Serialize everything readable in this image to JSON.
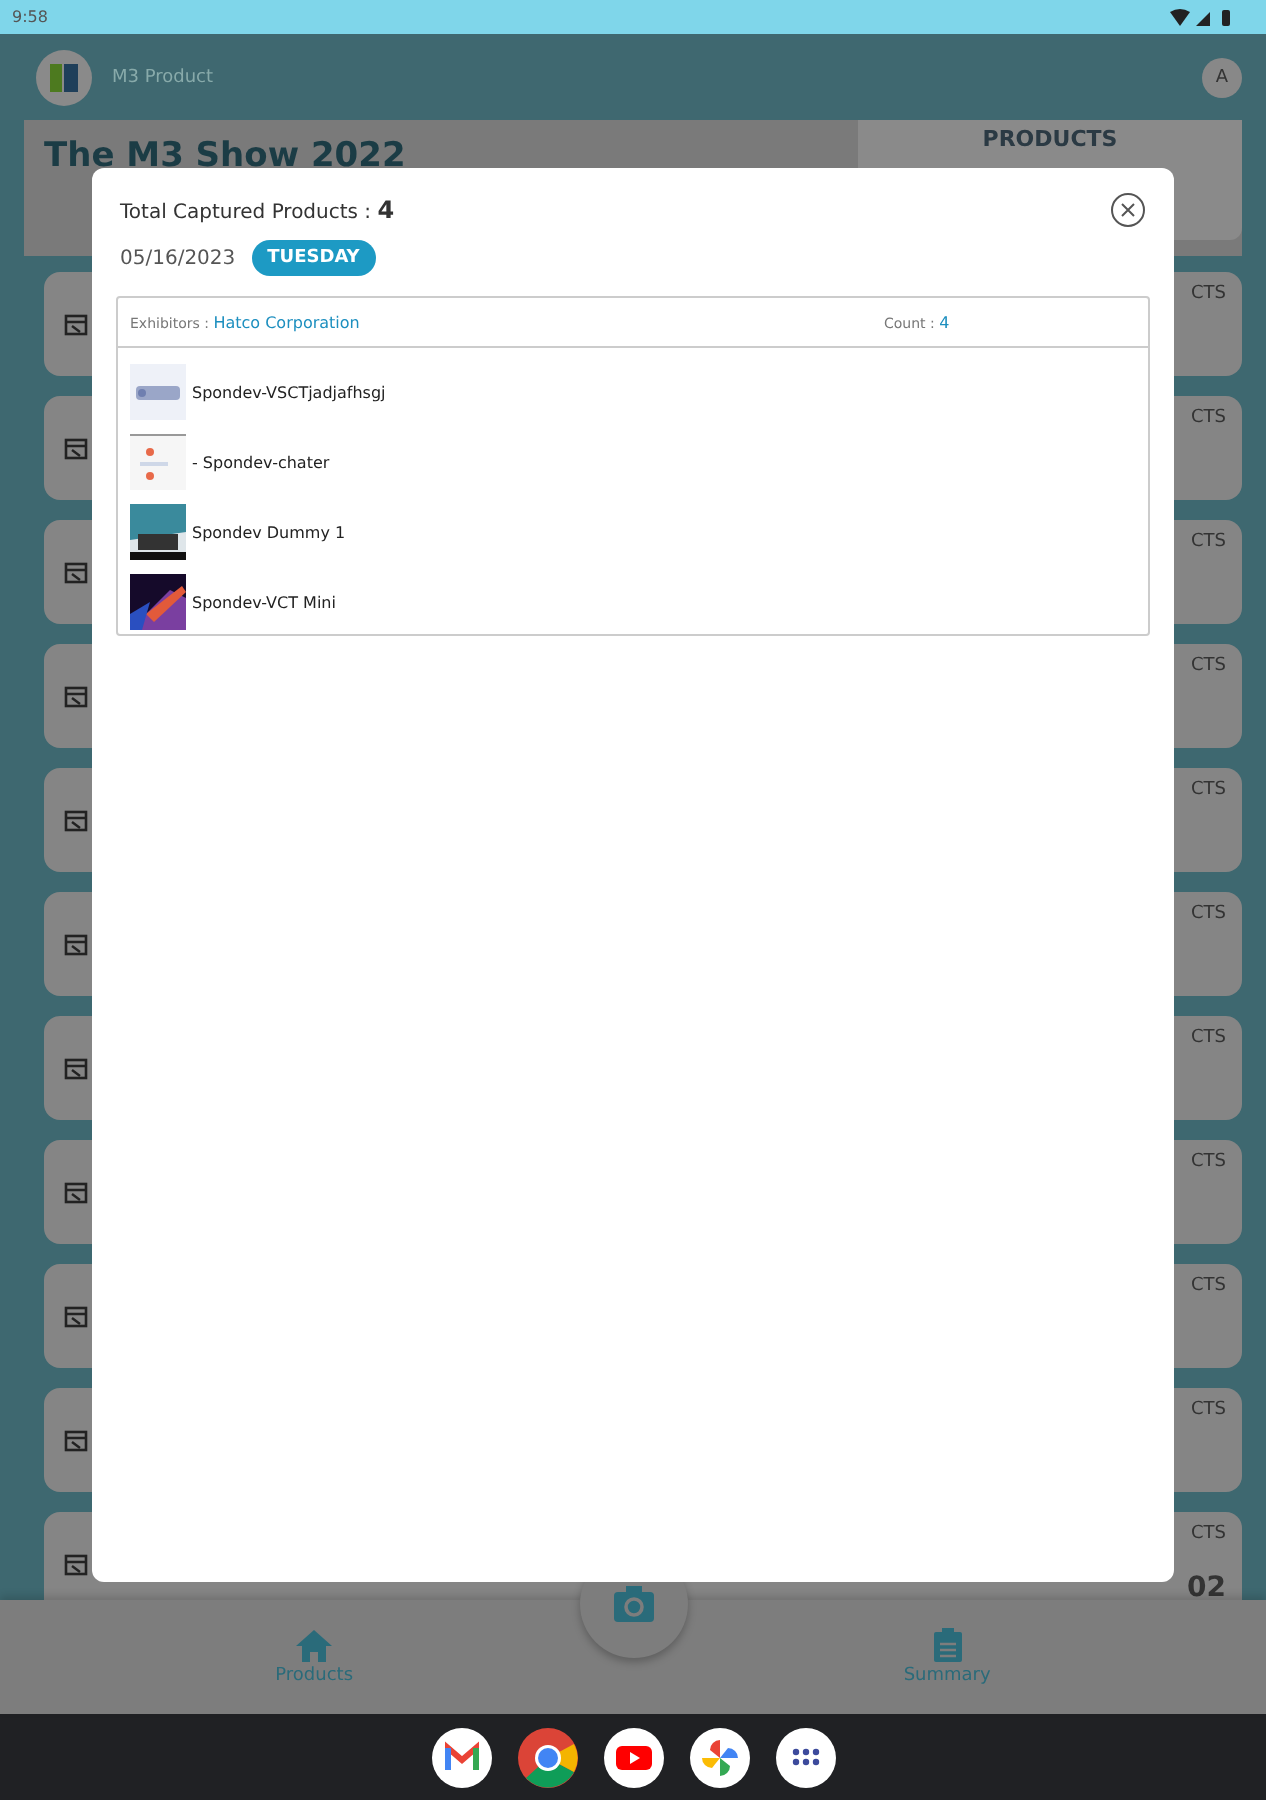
{
  "status_bar": {
    "time": "9:58"
  },
  "app_bar": {
    "title": "M3 Product",
    "avatar": "A"
  },
  "page": {
    "title": "The M3 Show 2022",
    "side_tab": "PRODUCTS"
  },
  "cards": [
    {
      "label": "CTS"
    },
    {
      "label": "CTS"
    },
    {
      "label": "CTS"
    },
    {
      "label": "CTS"
    },
    {
      "label": "CTS"
    },
    {
      "label": "CTS"
    },
    {
      "label": "CTS"
    },
    {
      "label": "CTS"
    },
    {
      "label": "CTS"
    },
    {
      "label": "CTS"
    },
    {
      "label": "CTS",
      "value": "02"
    }
  ],
  "bottom_nav": [
    {
      "kind": "home",
      "label": "Products"
    },
    {
      "kind": "summary",
      "label": "Summary"
    }
  ],
  "dialog": {
    "title": "Total Captured Products : ",
    "total": "4",
    "date": "05/16/2023",
    "day": "TUESDAY",
    "table": {
      "exhibitor_label": "Exhibitors : ",
      "exhibitor": "Hatco Corporation",
      "count_label": "Count : ",
      "count": "4",
      "rows": [
        {
          "kind": "picture",
          "name": "Spondev-VSCTjadjafhsgj"
        },
        {
          "kind": "picture",
          "name": "- Spondev-chater"
        },
        {
          "kind": "picture",
          "name": "Spondev Dummy 1"
        },
        {
          "kind": "picture",
          "name": "Spondev-VCT Mini"
        }
      ]
    }
  }
}
